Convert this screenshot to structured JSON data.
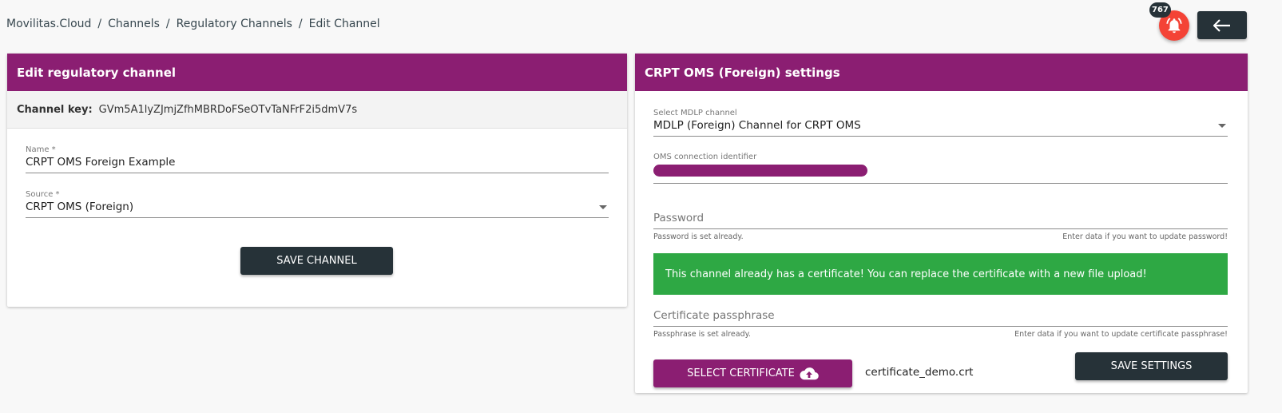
{
  "breadcrumb": [
    "Movilitas.Cloud",
    "Channels",
    "Regulatory Channels",
    "Edit Channel"
  ],
  "notifications": {
    "count": "767"
  },
  "left_card": {
    "title": "Edit regulatory channel",
    "key_label": "Channel key:",
    "key_value": "GVm5A1lyZJmjZfhMBRDoFSeOTvTaNFrF2i5dmV7s",
    "name_label": "Name *",
    "name_value": "CRPT OMS Foreign Example",
    "source_label": "Source *",
    "source_value": "CRPT OMS (Foreign)",
    "save_label": "SAVE CHANNEL"
  },
  "right_card": {
    "title": "CRPT OMS (Foreign) settings",
    "mdlp_label": "Select MDLP channel",
    "mdlp_value": "MDLP (Foreign) Channel for CRPT OMS",
    "oms_label": "OMS connection identifier",
    "password_placeholder": "Password",
    "password_hint_left": "Password is set already.",
    "password_hint_right": "Enter data if you want to update password!",
    "alert": "This channel already has a certificate! You can replace the certificate with a new file upload!",
    "passphrase_placeholder": "Certificate passphrase",
    "passphrase_hint_left": "Passphrase is set already.",
    "passphrase_hint_right": "Enter data if you want to update certificate passphrase!",
    "select_cert_label": "SELECT CERTIFICATE",
    "cert_filename": "certificate_demo.crt",
    "save_label": "SAVE SETTINGS"
  },
  "colors": {
    "brand": "#8b1e72",
    "dark": "#263238",
    "success": "#2ea844",
    "alert_red": "#f44336"
  },
  "icons": {
    "bell": "bell-alert-icon",
    "back": "arrow-left-icon",
    "upload": "cloud-upload-icon",
    "caret": "chevron-down-icon"
  }
}
